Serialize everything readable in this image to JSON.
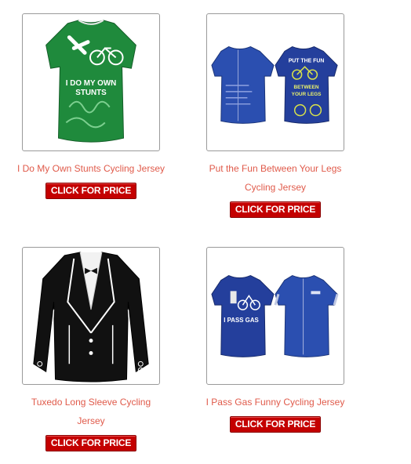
{
  "products": [
    {
      "name": "I Do My Own Stunts Cycling Jersey",
      "button": "CLICK FOR PRICE",
      "jersey_color": "#1f8a3c",
      "print": [
        "I DO MY OWN",
        "STUNTS"
      ]
    },
    {
      "name": "Put the Fun Between Your Legs Cycling Jersey",
      "button": "CLICK FOR PRICE",
      "jersey_color": "#2b4fb0",
      "print": [
        "PUT THE FUN",
        "BETWEEN",
        "YOUR LEGS"
      ]
    },
    {
      "name": "Tuxedo Long Sleeve Cycling Jersey",
      "button": "CLICK FOR PRICE",
      "jersey_color": "#111111",
      "print": []
    },
    {
      "name": "I Pass Gas Funny Cycling Jersey",
      "button": "CLICK FOR PRICE",
      "jersey_color": "#243f9c",
      "print": [
        "I PASS GAS"
      ]
    }
  ]
}
